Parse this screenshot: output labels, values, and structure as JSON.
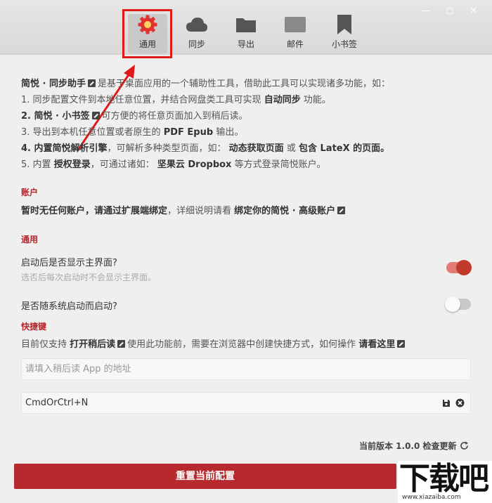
{
  "window": {
    "minimize": "—",
    "maximize": "☐",
    "close": "✕"
  },
  "tabs": [
    {
      "label": "通用",
      "icon": "gear-icon",
      "active": true
    },
    {
      "label": "同步",
      "icon": "cloud-icon"
    },
    {
      "label": "导出",
      "icon": "folder-icon"
    },
    {
      "label": "邮件",
      "icon": "mail-icon"
    },
    {
      "label": "小书签",
      "icon": "bookmark-icon"
    }
  ],
  "intro": {
    "title": "简悦 · 同步助手",
    "title_desc": "是基于桌面应用的一个辅助性工具，借助此工具可以实现诸多功能，如：",
    "item1_pre": "1. 同步配置文件到本地任意位置，并结合网盘类工具可实现",
    "item1_bold": "自动同步",
    "item1_post": "功能。",
    "item2_bold": "2. 简悦 · 小书签",
    "item2_post": "可方便的将任意页面加入到稍后读。",
    "item3_pre": "3. 导出到本机任意位置或者原生的",
    "item3_bold": "PDF Epub",
    "item3_post": "输出。",
    "item4_bold": "4. 内置简悦解析引擎",
    "item4_mid": "，可解析多种类型页面，如：",
    "item4_bold2": "动态获取页面",
    "item4_or": "或",
    "item4_bold3": "包含 LateX 的页面。",
    "item5_pre": "5. 内置",
    "item5_bold": "授权登录",
    "item5_mid": "，可通过诸如：",
    "item5_bold2": "坚果云 Dropbox",
    "item5_post": "等方式登录简悦账户。"
  },
  "account": {
    "section": "账户",
    "bold": "暂时无任何账户，请通过扩展端绑定",
    "mid": "，详细说明请看",
    "link": "绑定你的简悦 · 高级账户"
  },
  "general": {
    "section": "通用",
    "opt1_title": "启动后是否显示主界面?",
    "opt1_sub": "选否后每次启动时不会显示主界面。",
    "opt1_on": true,
    "opt2_title": "是否随系统启动而启动?",
    "opt2_on": false
  },
  "shortcut": {
    "section": "快捷键",
    "desc_pre": "目前仅支持",
    "desc_bold": "打开稍后读",
    "desc_mid": "使用此功能前，需要在浏览器中创建快捷方式，如何操作",
    "desc_link": "请看这里",
    "url_placeholder": "请填入稍后读 App 的地址",
    "key_value": "CmdOrCtrl+N"
  },
  "footer": {
    "version": "当前版本 1.0.0 检查更新",
    "reset": "重置当前配置"
  },
  "watermark": {
    "text": "下载吧",
    "url": "www.xiazaiba.com"
  },
  "colors": {
    "accent": "#b7292c",
    "highlight": "#e0191c"
  }
}
